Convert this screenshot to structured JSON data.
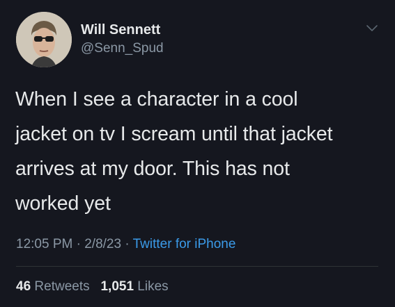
{
  "tweet": {
    "author": {
      "display_name": "Will Sennett",
      "handle": "@Senn_Spud",
      "avatar_icon": "user-avatar-sunglasses"
    },
    "menu_icon": "chevron-down-icon",
    "text_lines": [
      "When I see a character in a cool",
      "jacket on tv I scream until that jacket",
      "arrives at my door. This has not",
      "worked yet"
    ],
    "time": "12:05 PM",
    "separator": "·",
    "date": "2/8/23",
    "source": "Twitter for iPhone",
    "retweets_count": "46",
    "retweets_label": "Retweets",
    "likes_count": "1,051",
    "likes_label": "Likes"
  },
  "colors": {
    "background": "#15171f",
    "primary_text": "#e7e9ea",
    "secondary_text": "#8b98a5",
    "link": "#3b9be9",
    "divider": "#2f3336"
  }
}
